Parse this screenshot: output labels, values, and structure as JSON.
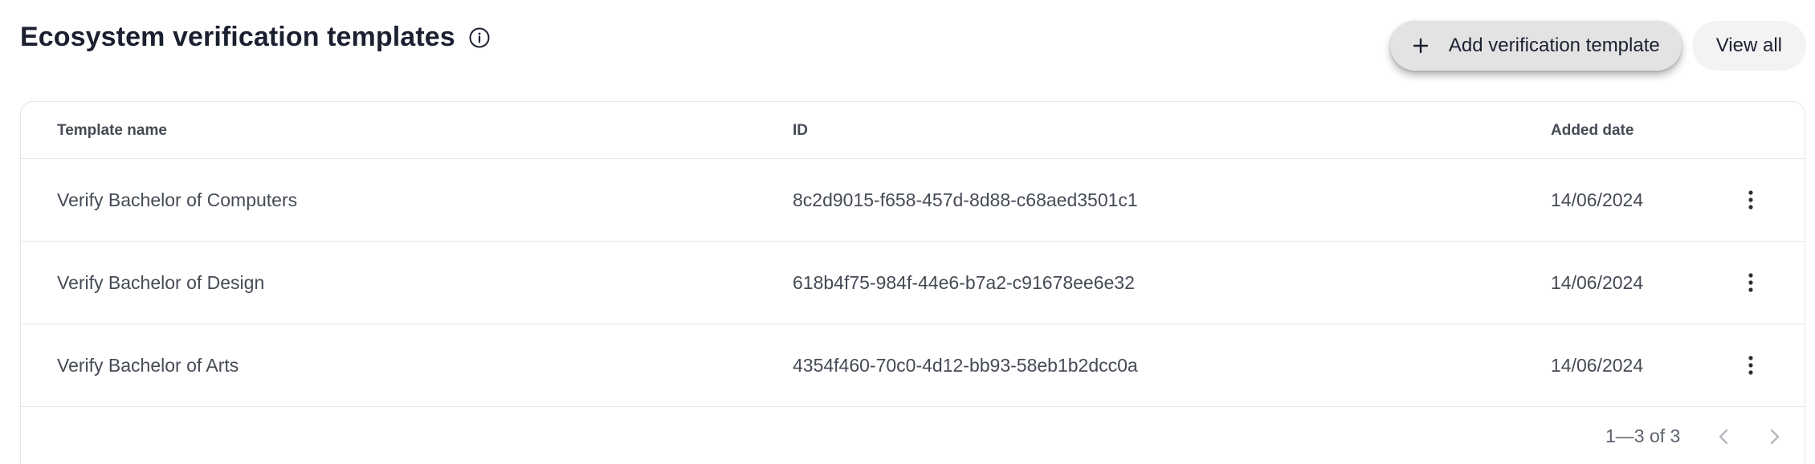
{
  "header": {
    "title": "Ecosystem verification templates",
    "info_icon": "info-circle-icon",
    "add_button_label": "Add verification template",
    "add_button_icon": "plus-icon",
    "view_all_label": "View all"
  },
  "table": {
    "columns": {
      "name": "Template name",
      "id": "ID",
      "date": "Added date"
    },
    "rows": [
      {
        "name": "Verify Bachelor of Computers",
        "id": "8c2d9015-f658-457d-8d88-c68aed3501c1",
        "date": "14/06/2024"
      },
      {
        "name": "Verify Bachelor of Design",
        "id": "618b4f75-984f-44e6-b7a2-c91678ee6e32",
        "date": "14/06/2024"
      },
      {
        "name": "Verify Bachelor of Arts",
        "id": "4354f460-70c0-4d12-bb93-58eb1b2dcc0a",
        "date": "14/06/2024"
      }
    ],
    "row_action_icon": "more-vertical-icon"
  },
  "pagination": {
    "range_text": "1—3 of 3",
    "prev_icon": "chevron-left-icon",
    "next_icon": "chevron-right-icon"
  },
  "colors": {
    "title": "#1b2030",
    "text": "#454b55",
    "border": "#e4e6ea",
    "add_button_bg": "#e3e3e3",
    "view_all_bg": "#f3f3f3",
    "pager_disabled": "#b5b9bf"
  }
}
